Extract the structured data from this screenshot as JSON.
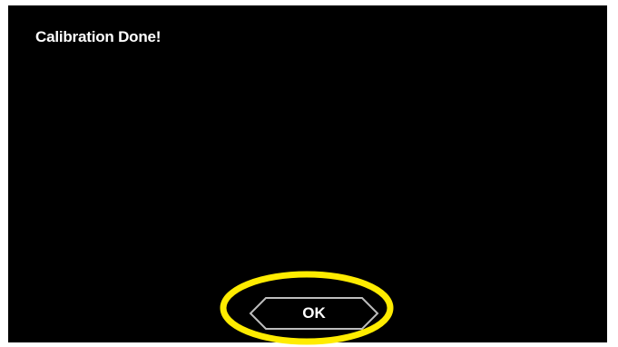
{
  "dialog": {
    "title": "Calibration Done!",
    "ok_label": "OK"
  },
  "colors": {
    "background": "#000000",
    "text": "#ffffff",
    "button_border": "#bdbdbd",
    "highlight": "#ffec00"
  },
  "icons": {
    "button_shape": "hexagon-button-outline",
    "annotation": "highlight-ellipse"
  }
}
